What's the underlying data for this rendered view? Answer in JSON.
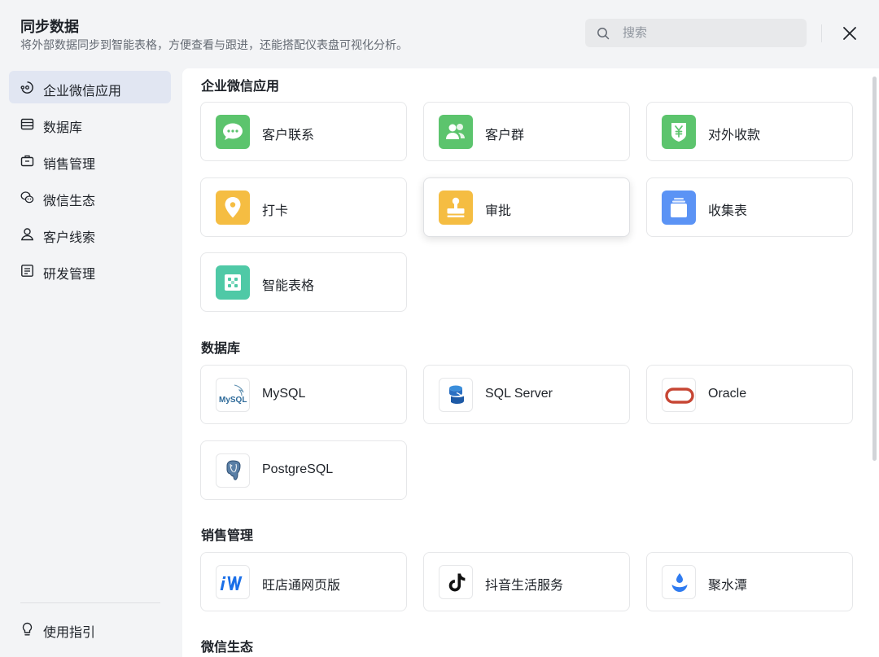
{
  "header": {
    "title": "同步数据",
    "subtitle": "将外部数据同步到智能表格，方便查看与跟进，还能搭配仪表盘可视化分析。",
    "search_placeholder": "搜索"
  },
  "sidebar": {
    "items": [
      {
        "label": "企业微信应用",
        "icon": "wecom-app-icon",
        "active": true
      },
      {
        "label": "数据库",
        "icon": "database-icon"
      },
      {
        "label": "销售管理",
        "icon": "briefcase-icon"
      },
      {
        "label": "微信生态",
        "icon": "wechat-icon"
      },
      {
        "label": "客户线索",
        "icon": "user-icon"
      },
      {
        "label": "研发管理",
        "icon": "document-list-icon"
      }
    ],
    "guide_label": "使用指引"
  },
  "sections": {
    "wecom": {
      "title": "企业微信应用",
      "cards": [
        {
          "label": "客户联系",
          "icon": "chat-bubble-icon",
          "color": "#5cc46d"
        },
        {
          "label": "客户群",
          "icon": "group-icon",
          "color": "#5cc46d"
        },
        {
          "label": "对外收款",
          "icon": "yuan-shield-icon",
          "color": "#5cc46d"
        },
        {
          "label": "打卡",
          "icon": "location-pin-icon",
          "color": "#f5bd42"
        },
        {
          "label": "审批",
          "icon": "stamp-icon",
          "color": "#f5bd42"
        },
        {
          "label": "收集表",
          "icon": "form-icon",
          "color": "#5b93f5"
        },
        {
          "label": "智能表格",
          "icon": "smart-sheet-icon",
          "color": "#4fc9a6"
        }
      ]
    },
    "database": {
      "title": "数据库",
      "cards": [
        {
          "label": "MySQL",
          "icon": "mysql-logo",
          "logo_text": "MySQL"
        },
        {
          "label": "SQL Server",
          "icon": "sql-server-logo"
        },
        {
          "label": "Oracle",
          "icon": "oracle-logo"
        },
        {
          "label": "PostgreSQL",
          "icon": "postgresql-logo"
        }
      ]
    },
    "sales": {
      "title": "销售管理",
      "cards": [
        {
          "label": "旺店通网页版",
          "icon": "wangdiantong-logo"
        },
        {
          "label": "抖音生活服务",
          "icon": "douyin-logo"
        },
        {
          "label": "聚水潭",
          "icon": "jushuitan-logo"
        }
      ]
    },
    "wechat": {
      "title": "微信生态"
    }
  },
  "colors": {
    "sidebar_active_bg": "#e1e6f2",
    "green": "#5cc46d",
    "yellow": "#f5bd42",
    "blue": "#5b93f5",
    "teal": "#4fc9a6",
    "oracle_red": "#c74634"
  }
}
